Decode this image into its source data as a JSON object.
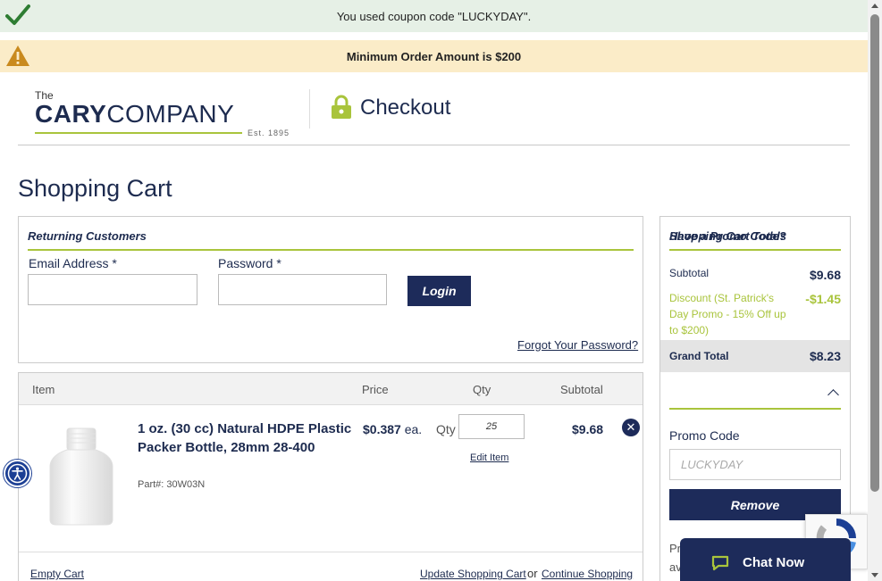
{
  "banners": {
    "success_text": "You used coupon code \"LUCKYDAY\".",
    "warning_text": "Minimum Order Amount is $200"
  },
  "header": {
    "logo_the": "The",
    "logo_cary": "CARY",
    "logo_company": "COMPANY",
    "logo_est": "Est. 1895",
    "checkout_title": "Checkout"
  },
  "page_title": "Shopping Cart",
  "login": {
    "heading": "Returning Customers",
    "email_label": "Email Address *",
    "email_value": "",
    "password_label": "Password *",
    "password_value": "",
    "login_button": "Login",
    "forgot_link": "Forgot Your Password?"
  },
  "cart": {
    "columns": {
      "item": "Item",
      "price": "Price",
      "qty": "Qty",
      "subtotal": "Subtotal"
    },
    "items": [
      {
        "name": "1 oz. (30 cc) Natural HDPE Plastic Packer Bottle, 28mm 28-400",
        "part_label": "Part#:",
        "part_number": "30W03N",
        "price_value": "$0.387",
        "price_unit": "ea.",
        "qty_label": "Qty",
        "qty": "25",
        "edit_link": "Edit Item",
        "subtotal": "$9.68",
        "remove_glyph": "✕"
      }
    ],
    "empty_cart_link": "Empty Cart",
    "update_cart_link": "Update Shopping Cart",
    "or_text": "or",
    "continue_link": "Continue Shopping"
  },
  "totals": {
    "heading": "Shopping Cart Totals",
    "subtotal_label": "Subtotal",
    "subtotal_value": "$9.68",
    "discount_label": "Discount (St. Patrick's Day Promo - 15% Off up to $200)",
    "discount_value": "-$1.45",
    "grand_total_label": "Grand Total",
    "grand_total_value": "$8.23",
    "promo_heading": "Have a Promo Code?",
    "promo_code_label": "Promo Code",
    "promo_placeholder": "LUCKYDAY",
    "remove_button": "Remove",
    "peek_line1": "Pr",
    "peek_line2": "av"
  },
  "chat": {
    "label": "Chat Now"
  },
  "colors": {
    "navy": "#1d2b5a",
    "lime": "#a9c43c",
    "success_bg": "#e6f0e6",
    "warning_bg": "#fbecc8",
    "accessibility_blue": "#1c3f94"
  },
  "icons": {
    "success": "checkmark-icon",
    "warning": "warning-triangle-icon",
    "lock": "lock-icon",
    "remove": "close-circle-icon",
    "collapse": "chevron-up-icon",
    "accessibility": "accessibility-icon",
    "chat": "chat-bubble-icon",
    "recaptcha": "recaptcha-icon"
  }
}
